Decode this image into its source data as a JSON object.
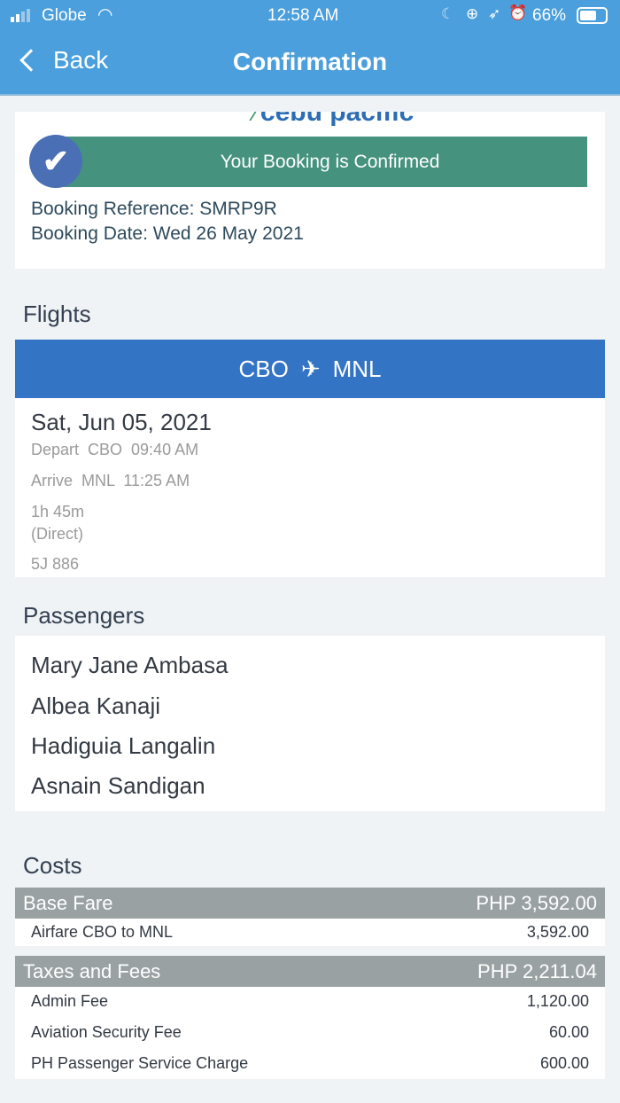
{
  "status_bar": {
    "carrier": "Globe",
    "time": "12:58 AM",
    "battery": "66%"
  },
  "nav": {
    "back_label": "Back",
    "title": "Confirmation"
  },
  "booking": {
    "logo_text": "cebu pacific",
    "banner": "Your Booking is Confirmed",
    "reference": "Booking Reference: SMRP9R",
    "date": "Booking Date: Wed 26 May 2021"
  },
  "flights": {
    "heading": "Flights",
    "origin": "CBO",
    "destination": "MNL",
    "date": "Sat, Jun 05, 2021",
    "depart": "Depart  CBO  09:40 AM",
    "arrive": "Arrive  MNL  11:25 AM",
    "duration": "1h 45m",
    "type": "(Direct)",
    "flight_no": "5J 886"
  },
  "passengers": {
    "heading": "Passengers",
    "names": [
      "Mary Jane Ambasa",
      "Albea Kanaji",
      "Hadiguia Langalin",
      "Asnain Sandigan"
    ]
  },
  "costs": {
    "heading": "Costs",
    "base": {
      "label": "Base Fare",
      "total": "PHP 3,592.00",
      "items": [
        {
          "label": "Airfare CBO to MNL",
          "amount": "3,592.00"
        }
      ]
    },
    "taxes": {
      "label": "Taxes and Fees",
      "total": "PHP 2,211.04",
      "items": [
        {
          "label": "Admin Fee",
          "amount": "1,120.00"
        },
        {
          "label": "Aviation Security Fee",
          "amount": "60.00"
        },
        {
          "label": "PH Passenger Service Charge",
          "amount": "600.00"
        }
      ]
    }
  },
  "colors": {
    "nav": "#4a9fdc",
    "banner": "#45927e",
    "route": "#3474c4",
    "cost_bar": "#9aa1a2"
  }
}
